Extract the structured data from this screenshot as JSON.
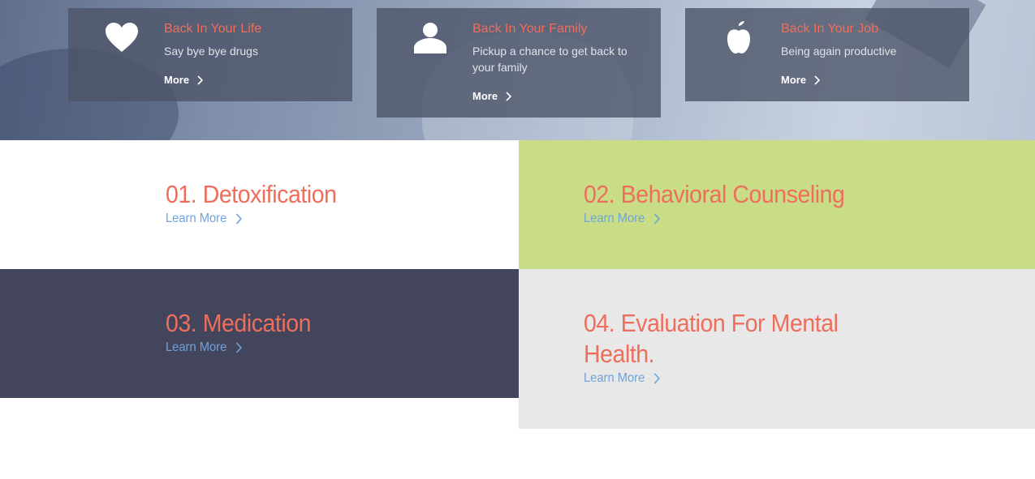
{
  "colors": {
    "accent": "#ee6e5e",
    "link": "#6fa3d8",
    "card_bg": "#4c5468",
    "green_panel": "#c9dd86",
    "navy_panel": "#42455c",
    "gray_panel": "#e8e8e8"
  },
  "features": [
    {
      "icon": "heart-icon",
      "title": "Back In Your Life",
      "desc": "Say bye bye drugs",
      "more": "More"
    },
    {
      "icon": "person-icon",
      "title": "Back In Your Family",
      "desc": "Pickup a chance to get back to your family",
      "more": "More"
    },
    {
      "icon": "apple-icon",
      "title": "Back In Your Job",
      "desc": "Being again productive",
      "more": "More"
    }
  ],
  "services": [
    {
      "title": "01. Detoxification",
      "link": "Learn More"
    },
    {
      "title": "02. Behavioral Counseling",
      "link": "Learn More"
    },
    {
      "title": "03. Medication",
      "link": "Learn More"
    },
    {
      "title": "04. Evaluation For Mental Health.",
      "link": "Learn More"
    }
  ]
}
